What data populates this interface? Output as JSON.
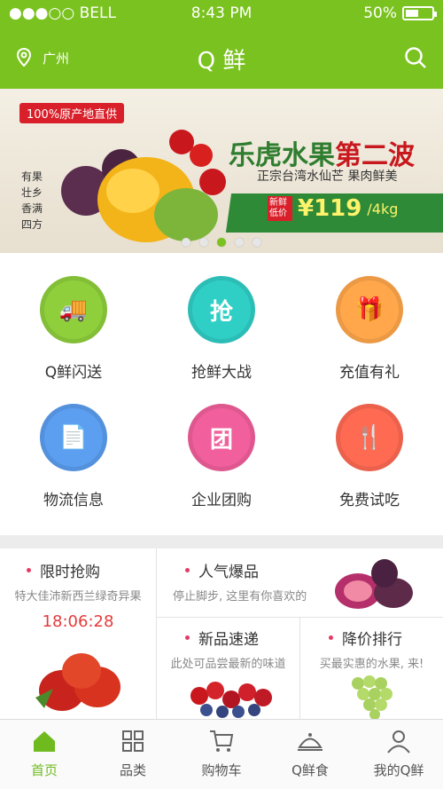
{
  "status_bar": {
    "carrier": "●●●○○ BELL",
    "time": "8:43 PM",
    "battery": "50%",
    "battery_level": 0.5
  },
  "header": {
    "location": "广州",
    "title": "Q 鲜"
  },
  "banner": {
    "tag": "100%原产地直供",
    "headline_green": "乐虎水果",
    "headline_red": "第二波",
    "subtitle": "正宗台湾水仙芒 果肉鲜美",
    "price_badge": "新鲜低价",
    "price": "¥119",
    "unit": "/4kg",
    "vertical_text": "有果壮乡 香满四方",
    "carousel": {
      "count": 5,
      "active": 3
    }
  },
  "features": [
    {
      "label": "Q鲜闪送",
      "icon": "delivery-truck-icon",
      "color": "#8fcf3c",
      "glyph": "🚚"
    },
    {
      "label": "抢鲜大战",
      "icon": "grab-icon",
      "color": "#30cfc6",
      "glyph": "抢"
    },
    {
      "label": "充值有礼",
      "icon": "gift-icon",
      "color": "#ffa74a",
      "glyph": "🎁"
    },
    {
      "label": "物流信息",
      "icon": "document-icon",
      "color": "#5c9ef0",
      "glyph": "📄"
    },
    {
      "label": "企业团购",
      "icon": "group-buy-icon",
      "color": "#f15f9c",
      "glyph": "团"
    },
    {
      "label": "免费试吃",
      "icon": "fork-spoon-icon",
      "color": "#ff6a52",
      "glyph": "🍴"
    }
  ],
  "promo": {
    "flash": {
      "title": "限时抢购",
      "desc": "特大佳沛新西兰绿奇异果",
      "timer": "18:06:28"
    },
    "hot": {
      "title": "人气爆品",
      "desc": "停止脚步, 这里有你喜欢的"
    },
    "new": {
      "title": "新品速递",
      "desc": "此处可品尝最新的味道"
    },
    "price_rank": {
      "title": "降价排行",
      "desc": "买最实惠的水果, 来!"
    }
  },
  "tabbar": [
    {
      "label": "首页",
      "icon": "home-icon",
      "active": true
    },
    {
      "label": "品类",
      "icon": "category-icon",
      "active": false
    },
    {
      "label": "购物车",
      "icon": "cart-icon",
      "active": false
    },
    {
      "label": "Q鲜食",
      "icon": "cloche-icon",
      "active": false
    },
    {
      "label": "我的Q鲜",
      "icon": "user-icon",
      "active": false
    }
  ]
}
